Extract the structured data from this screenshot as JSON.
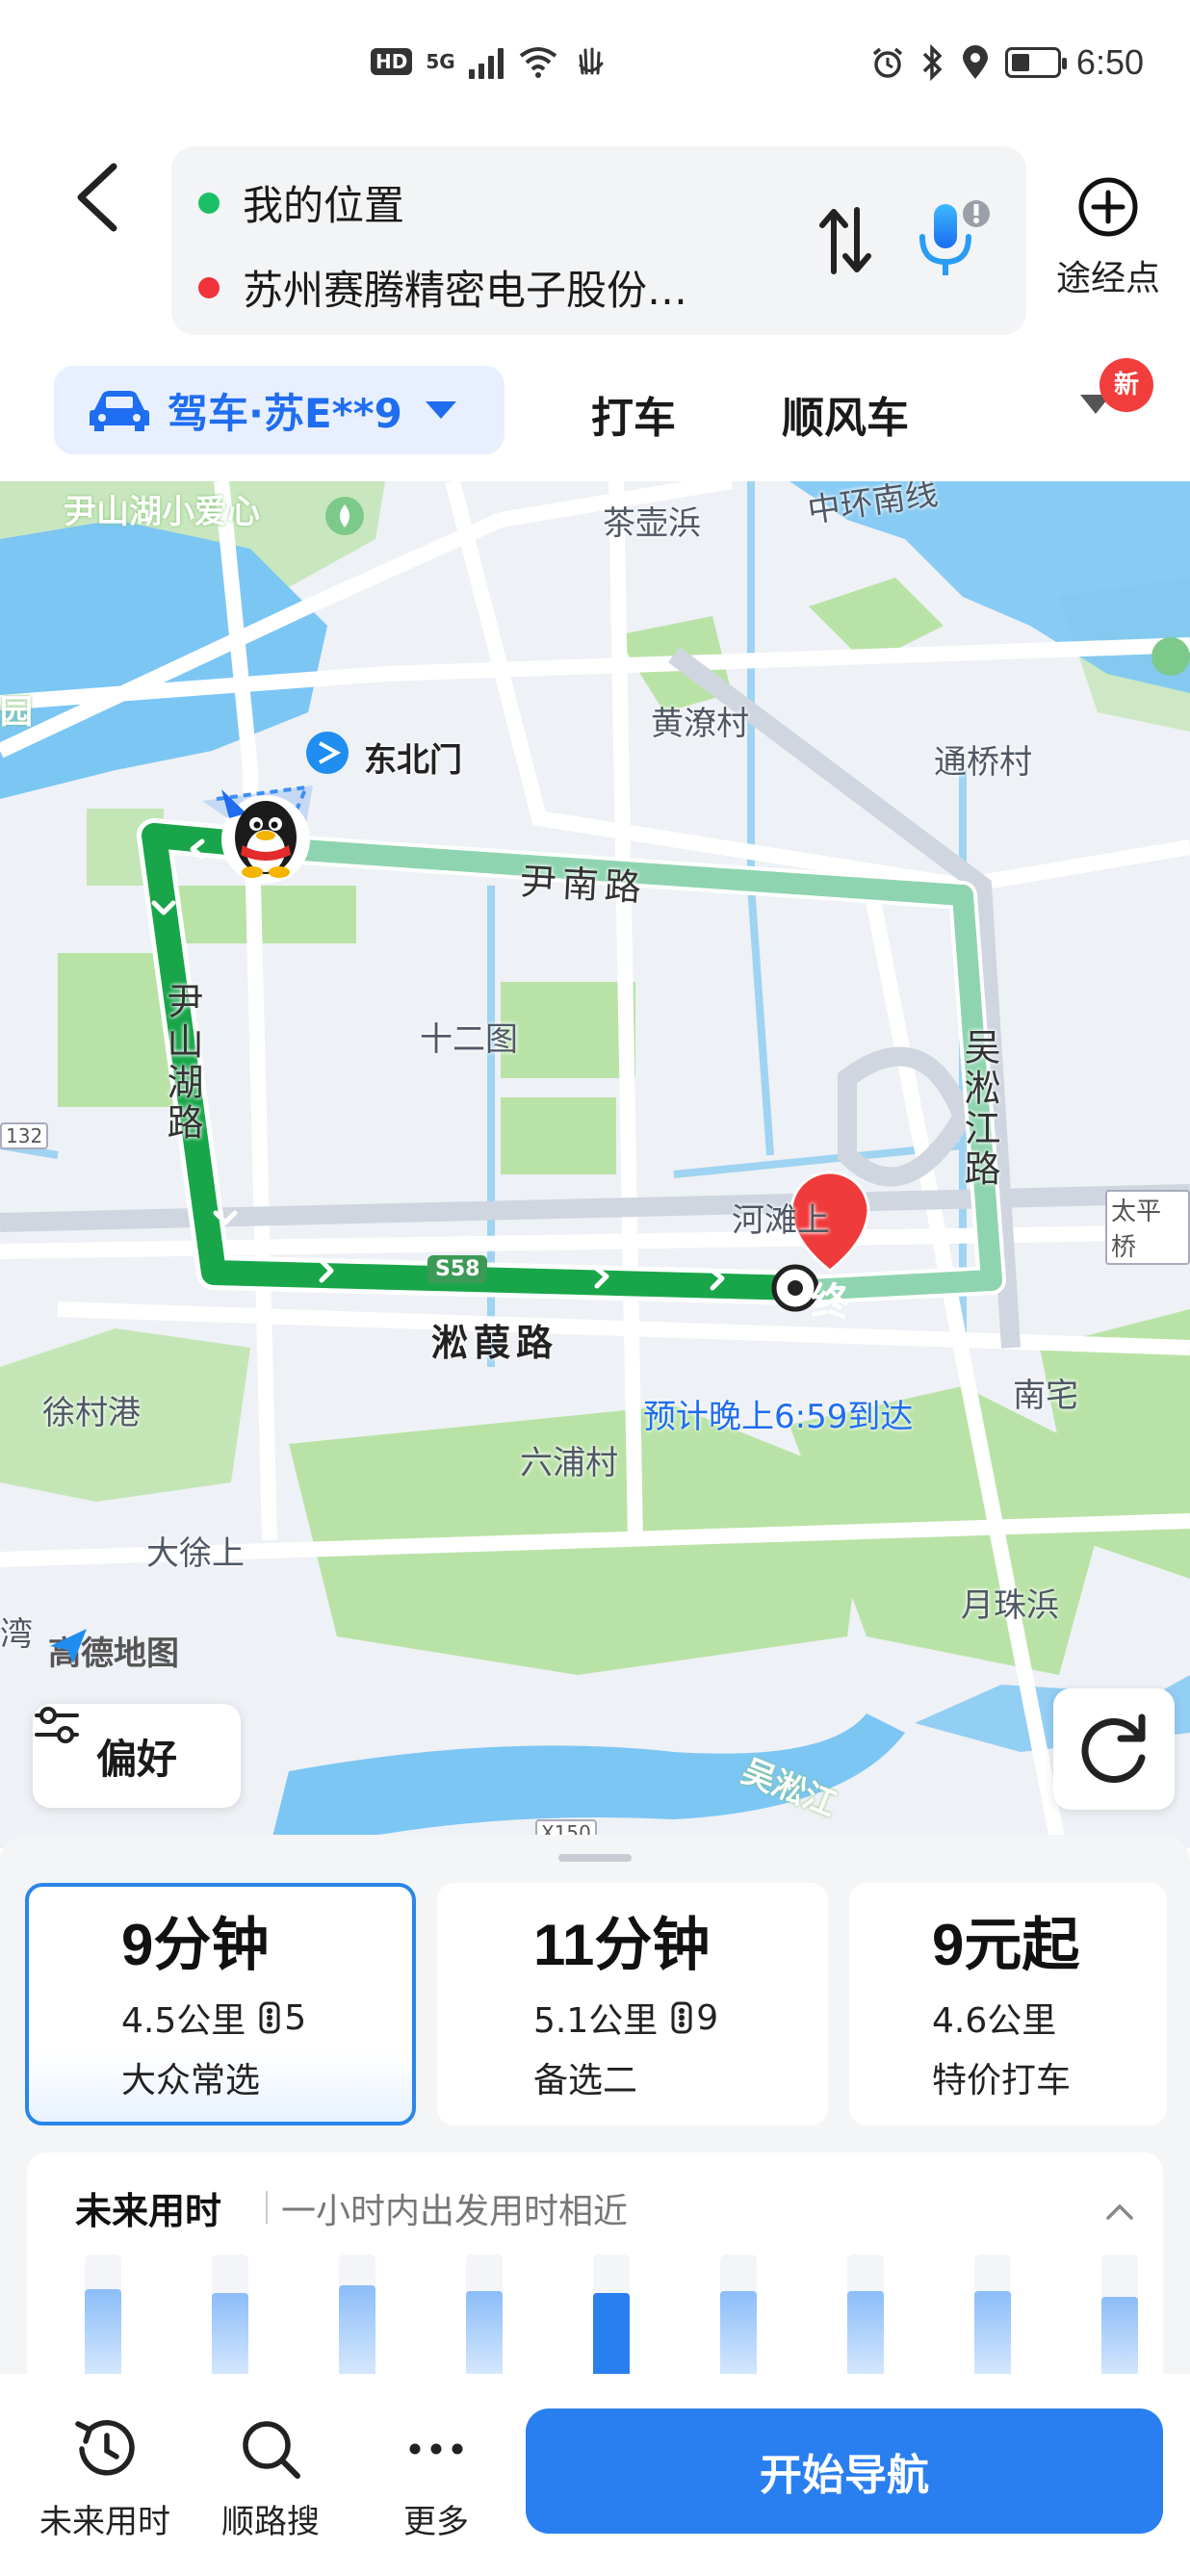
{
  "status_bar": {
    "hd": "HD",
    "net": "5G",
    "time": "6:50"
  },
  "route": {
    "from": "我的位置",
    "to": "苏州赛腾精密电子股份…",
    "via_label": "途经点"
  },
  "modes": {
    "drive": "驾车·苏E**9",
    "taxi": "打车",
    "carpool": "顺风车",
    "new_badge": "新"
  },
  "map": {
    "labels": {
      "yinshanhu": "尹山湖小爱心",
      "zhonghuan": "中环南线",
      "chahubang": "茶壶浜",
      "yuan": "园",
      "dongbeimen": "东北门",
      "huangliao": "黄潦村",
      "tongqiao": "通桥村",
      "yinnan": "尹南路",
      "shierwei": "十二图",
      "yinshanhu_road": "尹山湖路",
      "wusong_road": "吴淞江路",
      "r132": "132",
      "hetan": "河滩上",
      "taiping": "太平桥",
      "s58": "S58",
      "songjia": "淞葭路",
      "xucun": "徐村港",
      "nanzhai": "南宅",
      "liupu": "六浦村",
      "daxu": "大徐上",
      "yuezhu": "月珠浜",
      "wan": "湾",
      "wusongjiang": "吴淞江",
      "x150": "X150",
      "end_marker": "终"
    },
    "eta": "预计晚上6:59到达",
    "logo": "高德地图",
    "preference_button": "偏好"
  },
  "routes": [
    {
      "time": "9分钟",
      "distance": "4.5公里",
      "lights": "5",
      "tag": "大众常选",
      "selected": true
    },
    {
      "time": "11分钟",
      "distance": "5.1公里",
      "lights": "9",
      "tag": "备选二",
      "selected": false
    },
    {
      "time": "9元起",
      "distance": "4.6公里",
      "lights": "",
      "tag": "特价打车",
      "selected": false
    }
  ],
  "future": {
    "title": "未来用时",
    "subtitle": "一小时内出发用时相近",
    "bars": [
      0.95,
      0.92,
      0.98,
      0.93,
      0.92,
      0.93,
      0.93,
      0.93,
      0.88
    ],
    "current_index": 4
  },
  "toolbar": {
    "future": "未来用时",
    "along_search": "顺路搜",
    "more": "更多",
    "start": "开始导航"
  },
  "colors": {
    "accent": "#2a7ff0",
    "route_main": "#19a64a",
    "route_alt": "#8fd4b0",
    "end_marker": "#ef3b3b"
  }
}
